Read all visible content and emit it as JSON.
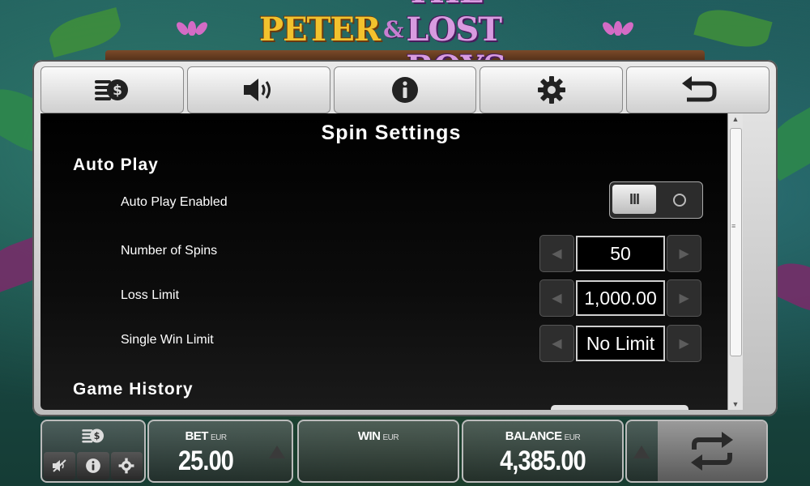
{
  "game": {
    "logo_part1": "PETER",
    "logo_amp": "&",
    "logo_part2": "THE LOST BOYS"
  },
  "tabs": [
    {
      "icon": "coins-stack-icon"
    },
    {
      "icon": "speaker-icon"
    },
    {
      "icon": "info-icon"
    },
    {
      "icon": "gear-icon"
    },
    {
      "icon": "return-arrow-icon"
    }
  ],
  "settings": {
    "title": "Spin Settings",
    "auto_play": {
      "heading": "Auto Play",
      "enabled_label": "Auto Play Enabled",
      "enabled": true,
      "spins_label": "Number of Spins",
      "spins_value": "50",
      "loss_label": "Loss Limit",
      "loss_value": "1,000.00",
      "win_label": "Single Win Limit",
      "win_value": "No Limit"
    },
    "history_heading": "Game History"
  },
  "bottom": {
    "bet_label": "BET",
    "bet_currency": "EUR",
    "bet_value": "25.00",
    "win_label": "WIN",
    "win_currency": "EUR",
    "win_value": "",
    "balance_label": "BALANCE",
    "balance_currency": "EUR",
    "balance_value": "4,385.00"
  },
  "colors": {
    "panel": "#d6d6d6",
    "content_bg": "#000000",
    "text": "#ffffff"
  }
}
